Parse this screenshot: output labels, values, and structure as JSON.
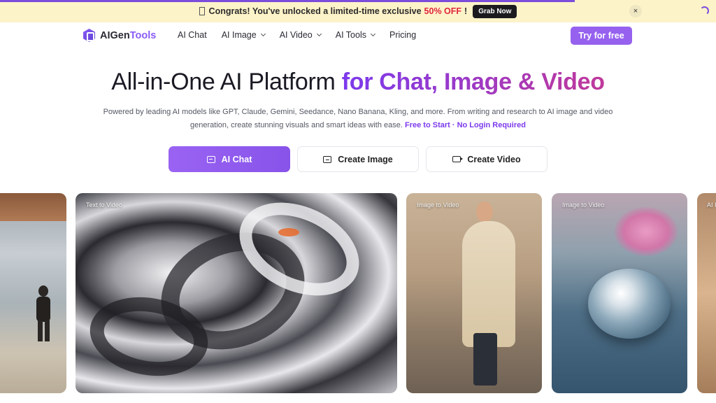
{
  "promo": {
    "text_before": "Congrats! You've unlocked a limited-time exclusive",
    "highlight": "50% OFF",
    "text_after": "!",
    "button": "Grab Now",
    "close": "×"
  },
  "brand": {
    "name_a": "AIGen",
    "name_b": "Tools",
    "accent": "#8b5cf6"
  },
  "nav": {
    "links": [
      "AI Chat",
      "AI Image",
      "AI Video",
      "AI Tools",
      "Pricing"
    ],
    "cta": "Try for free"
  },
  "hero": {
    "title_plain": "All-in-One AI Platform",
    "title_highlight": "for Chat, Image & Video",
    "subtitle": "Powered by leading AI models like GPT, Claude, Gemini, Seedance, Nano Banana, Kling, and more. From writing and research to AI image and video generation, create stunning visuals and smart ideas with ease.",
    "subtitle_em": "Free to Start · No Login Required",
    "buttons": {
      "chat": "AI Chat",
      "image": "Create Image",
      "video": "Create Video"
    }
  },
  "gallery": {
    "labels": [
      "Text to Video",
      "Image to Video",
      "Image to Video",
      "AI I"
    ]
  }
}
